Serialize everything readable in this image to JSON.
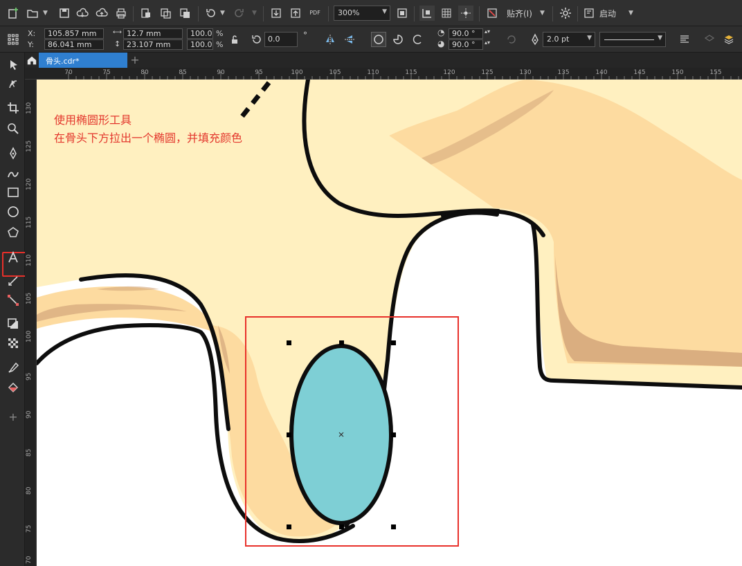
{
  "toolbar": {
    "zoom_value": "300%",
    "snap_label": "贴齐(I)",
    "launch_label": "启动",
    "pdf_label": "PDF"
  },
  "property_bar": {
    "x_label": "X:",
    "y_label": "Y:",
    "x_value": "105.857 mm",
    "y_value": "86.041 mm",
    "width_value": "12.7 mm",
    "height_value": "23.107 mm",
    "scale_x": "100.0",
    "scale_y": "100.0",
    "percent": "%",
    "rotation": "0.0",
    "degree": "°",
    "start_angle": "90.0 °",
    "end_angle": "90.0 °",
    "outline_width": "2.0 pt"
  },
  "tab": {
    "document_name": "骨头.cdr*"
  },
  "ruler": {
    "h_ticks": [
      "70",
      "75",
      "80",
      "85",
      "90",
      "95",
      "100",
      "105",
      "110",
      "115",
      "120",
      "125",
      "130",
      "135",
      "140",
      "145",
      "150",
      "155"
    ],
    "v_ticks": [
      "130",
      "125",
      "120",
      "115",
      "110",
      "105",
      "100",
      "95",
      "90",
      "85",
      "80",
      "75",
      "70"
    ]
  },
  "annotation": {
    "line1": "使用椭圆形工具",
    "line2": "在骨头下方拉出一个椭圆，并填充颜色"
  },
  "colors": {
    "bone_fill": "#FFF0C0",
    "bone_shade": "#FDDBA0",
    "bone_shadow": "#D3A67A",
    "ellipse_fill": "#7ECFD5",
    "outline": "#0D0D0D",
    "highlight": "#E8302A",
    "tab_active": "#2F7FD0"
  }
}
